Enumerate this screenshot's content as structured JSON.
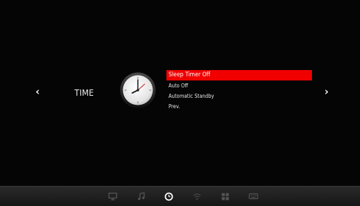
{
  "section": {
    "title": "TIME",
    "prev_arrow": "‹",
    "next_arrow": "›",
    "clock_icon": "clock-icon"
  },
  "menu": {
    "items": [
      {
        "label": "Sleep Timer Off",
        "selected": true
      },
      {
        "label": "Auto Off",
        "selected": false
      },
      {
        "label": "Automatic Standby",
        "selected": false
      },
      {
        "label": "Prev.",
        "selected": false
      }
    ]
  },
  "taskbar": {
    "icons": [
      "picture-icon",
      "music-note-icon",
      "clock-icon",
      "wifi-icon",
      "grid-icon",
      "keyboard-icon"
    ],
    "active": "clock-icon"
  },
  "colors": {
    "selected_bg": "#f10000",
    "background": "#050505",
    "clock_hand_red": "#c40000"
  }
}
